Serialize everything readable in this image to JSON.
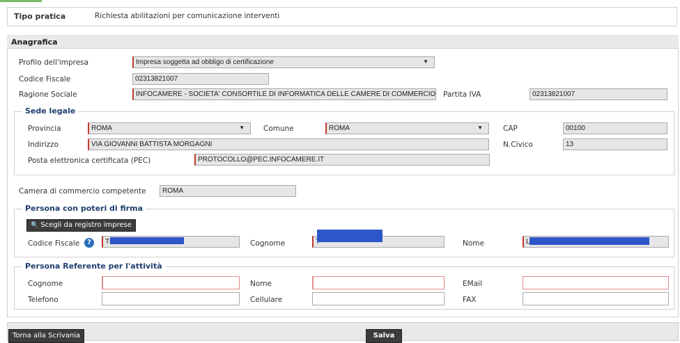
{
  "header": {
    "label": "Tipo pratica",
    "value": "Richiesta abilitazioni per comunicazione interventi"
  },
  "anagrafica": {
    "title": "Anagrafica",
    "profilo_label": "Profilo dell'impresa",
    "profilo_value": "Impresa soggetta ad obbligo di certificazione",
    "cf_label": "Codice Fiscale",
    "cf_value": "02313821007",
    "ragione_label": "Ragione Sociale",
    "ragione_value": "INFOCAMERE - SOCIETA' CONSORTILE DI INFORMATICA DELLE CAMERE DI COMMERCIO",
    "piva_label": "Partita IVA",
    "piva_value": "02313821007"
  },
  "sede": {
    "title": "Sede legale",
    "provincia_label": "Provincia",
    "provincia_value": "ROMA",
    "comune_label": "Comune",
    "comune_value": "ROMA",
    "cap_label": "CAP",
    "cap_value": "00100",
    "indirizzo_label": "Indirizzo",
    "indirizzo_value": "VIA GIOVANNI BATTISTA MORGAGNI",
    "civico_label": "N.Civico",
    "civico_value": "13",
    "pec_label": "Posta elettronica certificata (PEC)",
    "pec_value": "PROTOCOLLO@PEC.INFOCAMERE.IT"
  },
  "camera": {
    "label": "Camera di commercio competente",
    "value": "ROMA"
  },
  "firma": {
    "title": "Persona con poteri di firma",
    "choose_button": "Scegli da registro imprese",
    "cf_label": "Codice Fiscale",
    "cf_value": "TC",
    "cognome_label": "Cognome",
    "cognome_value": "T",
    "nome_label": "Nome",
    "nome_value": "Lo"
  },
  "referente": {
    "title": "Persona Referente per l'attività",
    "cognome_label": "Cognome",
    "nome_label": "Nome",
    "email_label": "EMail",
    "telefono_label": "Telefono",
    "cellulare_label": "Cellulare",
    "fax_label": "FAX"
  },
  "footer": {
    "back_button": "Torna alla Scrivania",
    "save_button": "Salva"
  },
  "colors": {
    "section_title": "#1f3f6e",
    "required_border": "#c0392b",
    "button_bg": "#3c3c3c",
    "redaction": "#2e56c9"
  }
}
